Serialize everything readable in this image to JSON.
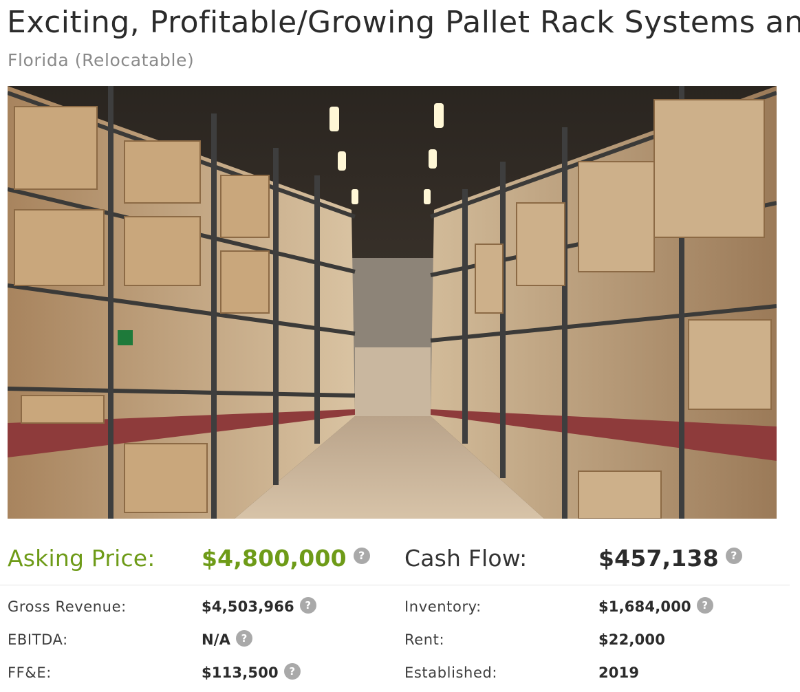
{
  "listing": {
    "title": "Exciting, Profitable/Growing Pallet Rack Systems an",
    "location": "Florida (Relocatable)"
  },
  "financials": {
    "asking_price": {
      "label": "Asking Price:",
      "value": "$4,800,000"
    },
    "cash_flow": {
      "label": "Cash Flow:",
      "value": "$457,138"
    },
    "gross_revenue": {
      "label": "Gross Revenue:",
      "value": "$4,503,966"
    },
    "inventory": {
      "label": "Inventory:",
      "value": "$1,684,000"
    },
    "ebitda": {
      "label": "EBITDA:",
      "value": "N/A"
    },
    "rent": {
      "label": "Rent:",
      "value": "$22,000"
    },
    "ffe": {
      "label": "FF&E:",
      "value": "$113,500"
    },
    "established": {
      "label": "Established:",
      "value": "2019"
    }
  },
  "help_icon_glyph": "?",
  "colors": {
    "accent_green": "#6e9b18",
    "help_icon_gray": "#a9a9a9"
  }
}
